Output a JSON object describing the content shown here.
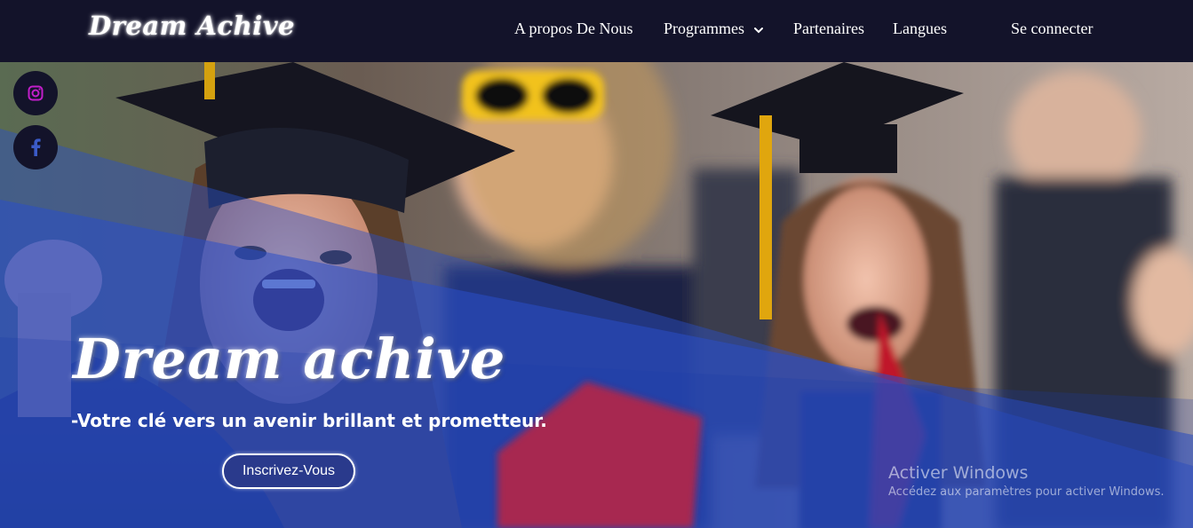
{
  "navbar": {
    "brand": "Dream Achive",
    "links": {
      "about": "A propos De Nous",
      "programs": "Programmes",
      "partners": "Partenaires",
      "languages": "Langues",
      "login": "Se connecter"
    }
  },
  "social": {
    "instagram_icon": "instagram-icon",
    "facebook_icon": "facebook-icon"
  },
  "hero": {
    "image": "graduates-celebrating-photo",
    "title": "Dream achive",
    "tagline": "-Votre clé vers un avenir brillant et prometteur.",
    "cta": "Inscrivez-Vous"
  },
  "watermark": {
    "title": "Activer Windows",
    "subtitle": "Accédez aux paramètres pour activer Windows."
  },
  "colors": {
    "navbar_bg": "#13132a",
    "overlay_blue": "#2a4fc8",
    "instagram_accent": "#c21ec9",
    "facebook_accent": "#3b5bc8"
  }
}
